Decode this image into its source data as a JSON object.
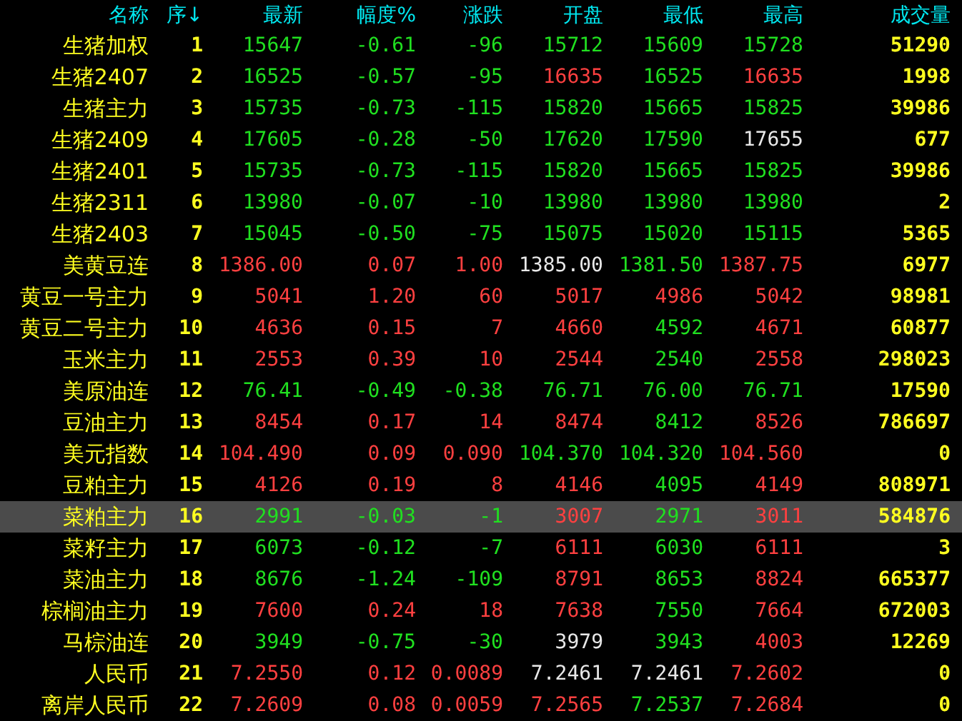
{
  "table": {
    "columns": [
      "名称",
      "序↓",
      "最新",
      "幅度%",
      "涨跌",
      "开盘",
      "最低",
      "最高",
      "成交量"
    ],
    "rows": [
      {
        "selected": false,
        "cells": [
          {
            "text": "生猪加权",
            "color": "#ffff20"
          },
          {
            "text": "1",
            "color": "#ffff20"
          },
          {
            "text": "15647",
            "color": "#20e020"
          },
          {
            "text": "-0.61",
            "color": "#20e020"
          },
          {
            "text": "-96",
            "color": "#20e020"
          },
          {
            "text": "15712",
            "color": "#20e020"
          },
          {
            "text": "15609",
            "color": "#20e020"
          },
          {
            "text": "15728",
            "color": "#20e020"
          },
          {
            "text": "51290",
            "color": "#ffff20"
          }
        ]
      },
      {
        "selected": false,
        "cells": [
          {
            "text": "生猪2407",
            "color": "#ffff20"
          },
          {
            "text": "2",
            "color": "#ffff20"
          },
          {
            "text": "16525",
            "color": "#20e020"
          },
          {
            "text": "-0.57",
            "color": "#20e020"
          },
          {
            "text": "-95",
            "color": "#20e020"
          },
          {
            "text": "16635",
            "color": "#ff4040"
          },
          {
            "text": "16525",
            "color": "#20e020"
          },
          {
            "text": "16635",
            "color": "#ff4040"
          },
          {
            "text": "1998",
            "color": "#ffff20"
          }
        ]
      },
      {
        "selected": false,
        "cells": [
          {
            "text": "生猪主力",
            "color": "#ffff20"
          },
          {
            "text": "3",
            "color": "#ffff20"
          },
          {
            "text": "15735",
            "color": "#20e020"
          },
          {
            "text": "-0.73",
            "color": "#20e020"
          },
          {
            "text": "-115",
            "color": "#20e020"
          },
          {
            "text": "15820",
            "color": "#20e020"
          },
          {
            "text": "15665",
            "color": "#20e020"
          },
          {
            "text": "15825",
            "color": "#20e020"
          },
          {
            "text": "39986",
            "color": "#ffff20"
          }
        ]
      },
      {
        "selected": false,
        "cells": [
          {
            "text": "生猪2409",
            "color": "#ffff20"
          },
          {
            "text": "4",
            "color": "#ffff20"
          },
          {
            "text": "17605",
            "color": "#20e020"
          },
          {
            "text": "-0.28",
            "color": "#20e020"
          },
          {
            "text": "-50",
            "color": "#20e020"
          },
          {
            "text": "17620",
            "color": "#20e020"
          },
          {
            "text": "17590",
            "color": "#20e020"
          },
          {
            "text": "17655",
            "color": "#e8e8e8"
          },
          {
            "text": "677",
            "color": "#ffff20"
          }
        ]
      },
      {
        "selected": false,
        "cells": [
          {
            "text": "生猪2401",
            "color": "#ffff20"
          },
          {
            "text": "5",
            "color": "#ffff20"
          },
          {
            "text": "15735",
            "color": "#20e020"
          },
          {
            "text": "-0.73",
            "color": "#20e020"
          },
          {
            "text": "-115",
            "color": "#20e020"
          },
          {
            "text": "15820",
            "color": "#20e020"
          },
          {
            "text": "15665",
            "color": "#20e020"
          },
          {
            "text": "15825",
            "color": "#20e020"
          },
          {
            "text": "39986",
            "color": "#ffff20"
          }
        ]
      },
      {
        "selected": false,
        "cells": [
          {
            "text": "生猪2311",
            "color": "#ffff20"
          },
          {
            "text": "6",
            "color": "#ffff20"
          },
          {
            "text": "13980",
            "color": "#20e020"
          },
          {
            "text": "-0.07",
            "color": "#20e020"
          },
          {
            "text": "-10",
            "color": "#20e020"
          },
          {
            "text": "13980",
            "color": "#20e020"
          },
          {
            "text": "13980",
            "color": "#20e020"
          },
          {
            "text": "13980",
            "color": "#20e020"
          },
          {
            "text": "2",
            "color": "#ffff20"
          }
        ]
      },
      {
        "selected": false,
        "cells": [
          {
            "text": "生猪2403",
            "color": "#ffff20"
          },
          {
            "text": "7",
            "color": "#ffff20"
          },
          {
            "text": "15045",
            "color": "#20e020"
          },
          {
            "text": "-0.50",
            "color": "#20e020"
          },
          {
            "text": "-75",
            "color": "#20e020"
          },
          {
            "text": "15075",
            "color": "#20e020"
          },
          {
            "text": "15020",
            "color": "#20e020"
          },
          {
            "text": "15115",
            "color": "#20e020"
          },
          {
            "text": "5365",
            "color": "#ffff20"
          }
        ]
      },
      {
        "selected": false,
        "cells": [
          {
            "text": "美黄豆连",
            "color": "#ffff20"
          },
          {
            "text": "8",
            "color": "#ffff20"
          },
          {
            "text": "1386.00",
            "color": "#ff4040"
          },
          {
            "text": "0.07",
            "color": "#ff4040"
          },
          {
            "text": "1.00",
            "color": "#ff4040"
          },
          {
            "text": "1385.00",
            "color": "#e8e8e8"
          },
          {
            "text": "1381.50",
            "color": "#20e020"
          },
          {
            "text": "1387.75",
            "color": "#ff4040"
          },
          {
            "text": "6977",
            "color": "#ffff20"
          }
        ]
      },
      {
        "selected": false,
        "cells": [
          {
            "text": "黄豆一号主力",
            "color": "#ffff20"
          },
          {
            "text": "9",
            "color": "#ffff20"
          },
          {
            "text": "5041",
            "color": "#ff4040"
          },
          {
            "text": "1.20",
            "color": "#ff4040"
          },
          {
            "text": "60",
            "color": "#ff4040"
          },
          {
            "text": "5017",
            "color": "#ff4040"
          },
          {
            "text": "4986",
            "color": "#ff4040"
          },
          {
            "text": "5042",
            "color": "#ff4040"
          },
          {
            "text": "98981",
            "color": "#ffff20"
          }
        ]
      },
      {
        "selected": false,
        "cells": [
          {
            "text": "黄豆二号主力",
            "color": "#ffff20"
          },
          {
            "text": "10",
            "color": "#ffff20"
          },
          {
            "text": "4636",
            "color": "#ff4040"
          },
          {
            "text": "0.15",
            "color": "#ff4040"
          },
          {
            "text": "7",
            "color": "#ff4040"
          },
          {
            "text": "4660",
            "color": "#ff4040"
          },
          {
            "text": "4592",
            "color": "#20e020"
          },
          {
            "text": "4671",
            "color": "#ff4040"
          },
          {
            "text": "60877",
            "color": "#ffff20"
          }
        ]
      },
      {
        "selected": false,
        "cells": [
          {
            "text": "玉米主力",
            "color": "#ffff20"
          },
          {
            "text": "11",
            "color": "#ffff20"
          },
          {
            "text": "2553",
            "color": "#ff4040"
          },
          {
            "text": "0.39",
            "color": "#ff4040"
          },
          {
            "text": "10",
            "color": "#ff4040"
          },
          {
            "text": "2544",
            "color": "#ff4040"
          },
          {
            "text": "2540",
            "color": "#20e020"
          },
          {
            "text": "2558",
            "color": "#ff4040"
          },
          {
            "text": "298023",
            "color": "#ffff20"
          }
        ]
      },
      {
        "selected": false,
        "cells": [
          {
            "text": "美原油连",
            "color": "#ffff20"
          },
          {
            "text": "12",
            "color": "#ffff20"
          },
          {
            "text": "76.41",
            "color": "#20e020"
          },
          {
            "text": "-0.49",
            "color": "#20e020"
          },
          {
            "text": "-0.38",
            "color": "#20e020"
          },
          {
            "text": "76.71",
            "color": "#20e020"
          },
          {
            "text": "76.00",
            "color": "#20e020"
          },
          {
            "text": "76.71",
            "color": "#20e020"
          },
          {
            "text": "17590",
            "color": "#ffff20"
          }
        ]
      },
      {
        "selected": false,
        "cells": [
          {
            "text": "豆油主力",
            "color": "#ffff20"
          },
          {
            "text": "13",
            "color": "#ffff20"
          },
          {
            "text": "8454",
            "color": "#ff4040"
          },
          {
            "text": "0.17",
            "color": "#ff4040"
          },
          {
            "text": "14",
            "color": "#ff4040"
          },
          {
            "text": "8474",
            "color": "#ff4040"
          },
          {
            "text": "8412",
            "color": "#20e020"
          },
          {
            "text": "8526",
            "color": "#ff4040"
          },
          {
            "text": "786697",
            "color": "#ffff20"
          }
        ]
      },
      {
        "selected": false,
        "cells": [
          {
            "text": "美元指数",
            "color": "#ffff20"
          },
          {
            "text": "14",
            "color": "#ffff20"
          },
          {
            "text": "104.490",
            "color": "#ff4040"
          },
          {
            "text": "0.09",
            "color": "#ff4040"
          },
          {
            "text": "0.090",
            "color": "#ff4040"
          },
          {
            "text": "104.370",
            "color": "#20e020"
          },
          {
            "text": "104.320",
            "color": "#20e020"
          },
          {
            "text": "104.560",
            "color": "#ff4040"
          },
          {
            "text": "0",
            "color": "#ffff20"
          }
        ]
      },
      {
        "selected": false,
        "cells": [
          {
            "text": "豆粕主力",
            "color": "#ffff20"
          },
          {
            "text": "15",
            "color": "#ffff20"
          },
          {
            "text": "4126",
            "color": "#ff4040"
          },
          {
            "text": "0.19",
            "color": "#ff4040"
          },
          {
            "text": "8",
            "color": "#ff4040"
          },
          {
            "text": "4146",
            "color": "#ff4040"
          },
          {
            "text": "4095",
            "color": "#20e020"
          },
          {
            "text": "4149",
            "color": "#ff4040"
          },
          {
            "text": "808971",
            "color": "#ffff20"
          }
        ]
      },
      {
        "selected": true,
        "cells": [
          {
            "text": "菜粕主力",
            "color": "#ffff20"
          },
          {
            "text": "16",
            "color": "#ffff20"
          },
          {
            "text": "2991",
            "color": "#20e020"
          },
          {
            "text": "-0.03",
            "color": "#20e020"
          },
          {
            "text": "-1",
            "color": "#20e020"
          },
          {
            "text": "3007",
            "color": "#ff4040"
          },
          {
            "text": "2971",
            "color": "#20e020"
          },
          {
            "text": "3011",
            "color": "#ff4040"
          },
          {
            "text": "584876",
            "color": "#ffff20"
          }
        ]
      },
      {
        "selected": false,
        "cells": [
          {
            "text": "菜籽主力",
            "color": "#ffff20"
          },
          {
            "text": "17",
            "color": "#ffff20"
          },
          {
            "text": "6073",
            "color": "#20e020"
          },
          {
            "text": "-0.12",
            "color": "#20e020"
          },
          {
            "text": "-7",
            "color": "#20e020"
          },
          {
            "text": "6111",
            "color": "#ff4040"
          },
          {
            "text": "6030",
            "color": "#20e020"
          },
          {
            "text": "6111",
            "color": "#ff4040"
          },
          {
            "text": "3",
            "color": "#ffff20"
          }
        ]
      },
      {
        "selected": false,
        "cells": [
          {
            "text": "菜油主力",
            "color": "#ffff20"
          },
          {
            "text": "18",
            "color": "#ffff20"
          },
          {
            "text": "8676",
            "color": "#20e020"
          },
          {
            "text": "-1.24",
            "color": "#20e020"
          },
          {
            "text": "-109",
            "color": "#20e020"
          },
          {
            "text": "8791",
            "color": "#ff4040"
          },
          {
            "text": "8653",
            "color": "#20e020"
          },
          {
            "text": "8824",
            "color": "#ff4040"
          },
          {
            "text": "665377",
            "color": "#ffff20"
          }
        ]
      },
      {
        "selected": false,
        "cells": [
          {
            "text": "棕榈油主力",
            "color": "#ffff20"
          },
          {
            "text": "19",
            "color": "#ffff20"
          },
          {
            "text": "7600",
            "color": "#ff4040"
          },
          {
            "text": "0.24",
            "color": "#ff4040"
          },
          {
            "text": "18",
            "color": "#ff4040"
          },
          {
            "text": "7638",
            "color": "#ff4040"
          },
          {
            "text": "7550",
            "color": "#20e020"
          },
          {
            "text": "7664",
            "color": "#ff4040"
          },
          {
            "text": "672003",
            "color": "#ffff20"
          }
        ]
      },
      {
        "selected": false,
        "cells": [
          {
            "text": "马棕油连",
            "color": "#ffff20"
          },
          {
            "text": "20",
            "color": "#ffff20"
          },
          {
            "text": "3949",
            "color": "#20e020"
          },
          {
            "text": "-0.75",
            "color": "#20e020"
          },
          {
            "text": "-30",
            "color": "#20e020"
          },
          {
            "text": "3979",
            "color": "#e8e8e8"
          },
          {
            "text": "3943",
            "color": "#20e020"
          },
          {
            "text": "4003",
            "color": "#ff4040"
          },
          {
            "text": "12269",
            "color": "#ffff20"
          }
        ]
      },
      {
        "selected": false,
        "cells": [
          {
            "text": "人民币",
            "color": "#ffff20"
          },
          {
            "text": "21",
            "color": "#ffff20"
          },
          {
            "text": "7.2550",
            "color": "#ff4040"
          },
          {
            "text": "0.12",
            "color": "#ff4040"
          },
          {
            "text": "0.0089",
            "color": "#ff4040"
          },
          {
            "text": "7.2461",
            "color": "#e8e8e8"
          },
          {
            "text": "7.2461",
            "color": "#e8e8e8"
          },
          {
            "text": "7.2602",
            "color": "#ff4040"
          },
          {
            "text": "0",
            "color": "#ffff20"
          }
        ]
      },
      {
        "selected": false,
        "cells": [
          {
            "text": "离岸人民币",
            "color": "#ffff20"
          },
          {
            "text": "22",
            "color": "#ffff20"
          },
          {
            "text": "7.2609",
            "color": "#ff4040"
          },
          {
            "text": "0.08",
            "color": "#ff4040"
          },
          {
            "text": "0.0059",
            "color": "#ff4040"
          },
          {
            "text": "7.2565",
            "color": "#ff4040"
          },
          {
            "text": "7.2537",
            "color": "#20e020"
          },
          {
            "text": "7.2684",
            "color": "#ff4040"
          },
          {
            "text": "0",
            "color": "#ffff20"
          }
        ]
      }
    ]
  }
}
